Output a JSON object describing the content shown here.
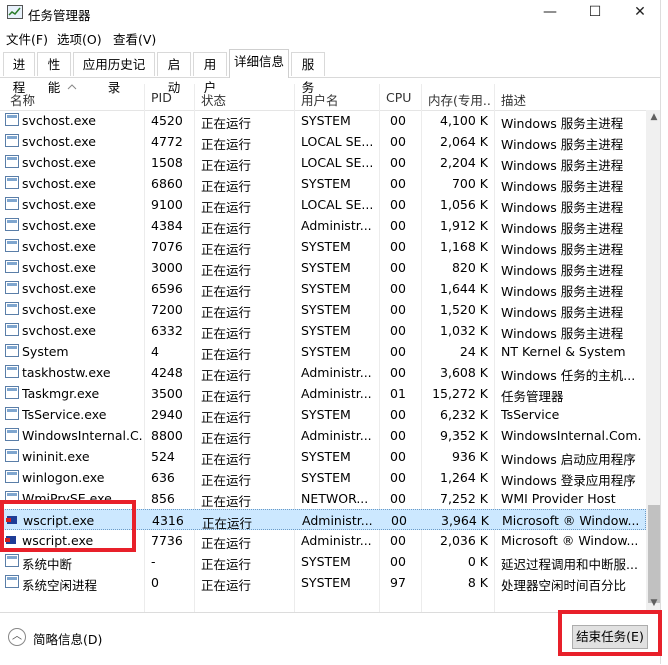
{
  "window": {
    "title": "任务管理器",
    "minimize": "—",
    "maximize": "☐",
    "close": "✕"
  },
  "menu": [
    "文件(F)",
    "选项(O)",
    "查看(V)"
  ],
  "tabs": [
    "进程",
    "性能",
    "应用历史记录",
    "启动",
    "用户",
    "详细信息",
    "服务"
  ],
  "active_tab": "详细信息",
  "columns": {
    "name": "名称",
    "pid": "PID",
    "status": "状态",
    "user": "用户名",
    "cpu": "CPU",
    "mem": "内存(专用...",
    "desc": "描述"
  },
  "rows": [
    {
      "name": "svchost.exe",
      "pid": "4520",
      "status": "正在运行",
      "user": "SYSTEM",
      "cpu": "00",
      "mem": "4,100 K",
      "desc": "Windows 服务主进程"
    },
    {
      "name": "svchost.exe",
      "pid": "4772",
      "status": "正在运行",
      "user": "LOCAL SE...",
      "cpu": "00",
      "mem": "2,064 K",
      "desc": "Windows 服务主进程"
    },
    {
      "name": "svchost.exe",
      "pid": "1508",
      "status": "正在运行",
      "user": "LOCAL SE...",
      "cpu": "00",
      "mem": "2,204 K",
      "desc": "Windows 服务主进程"
    },
    {
      "name": "svchost.exe",
      "pid": "6860",
      "status": "正在运行",
      "user": "SYSTEM",
      "cpu": "00",
      "mem": "700 K",
      "desc": "Windows 服务主进程"
    },
    {
      "name": "svchost.exe",
      "pid": "9100",
      "status": "正在运行",
      "user": "LOCAL SE...",
      "cpu": "00",
      "mem": "1,056 K",
      "desc": "Windows 服务主进程"
    },
    {
      "name": "svchost.exe",
      "pid": "4384",
      "status": "正在运行",
      "user": "Administr...",
      "cpu": "00",
      "mem": "1,912 K",
      "desc": "Windows 服务主进程"
    },
    {
      "name": "svchost.exe",
      "pid": "7076",
      "status": "正在运行",
      "user": "SYSTEM",
      "cpu": "00",
      "mem": "1,168 K",
      "desc": "Windows 服务主进程"
    },
    {
      "name": "svchost.exe",
      "pid": "3000",
      "status": "正在运行",
      "user": "SYSTEM",
      "cpu": "00",
      "mem": "820 K",
      "desc": "Windows 服务主进程"
    },
    {
      "name": "svchost.exe",
      "pid": "6596",
      "status": "正在运行",
      "user": "SYSTEM",
      "cpu": "00",
      "mem": "1,644 K",
      "desc": "Windows 服务主进程"
    },
    {
      "name": "svchost.exe",
      "pid": "7200",
      "status": "正在运行",
      "user": "SYSTEM",
      "cpu": "00",
      "mem": "1,520 K",
      "desc": "Windows 服务主进程"
    },
    {
      "name": "svchost.exe",
      "pid": "6332",
      "status": "正在运行",
      "user": "SYSTEM",
      "cpu": "00",
      "mem": "1,032 K",
      "desc": "Windows 服务主进程"
    },
    {
      "name": "System",
      "pid": "4",
      "status": "正在运行",
      "user": "SYSTEM",
      "cpu": "00",
      "mem": "24 K",
      "desc": "NT Kernel & System"
    },
    {
      "name": "taskhostw.exe",
      "pid": "4248",
      "status": "正在运行",
      "user": "Administr...",
      "cpu": "00",
      "mem": "3,608 K",
      "desc": "Windows 任务的主机..."
    },
    {
      "name": "Taskmgr.exe",
      "pid": "3500",
      "status": "正在运行",
      "user": "Administr...",
      "cpu": "01",
      "mem": "15,272 K",
      "desc": "任务管理器"
    },
    {
      "name": "TsService.exe",
      "pid": "2940",
      "status": "正在运行",
      "user": "SYSTEM",
      "cpu": "00",
      "mem": "6,232 K",
      "desc": "TsService"
    },
    {
      "name": "WindowsInternal.C...",
      "pid": "8800",
      "status": "正在运行",
      "user": "Administr...",
      "cpu": "00",
      "mem": "9,352 K",
      "desc": "WindowsInternal.Com..."
    },
    {
      "name": "wininit.exe",
      "pid": "524",
      "status": "正在运行",
      "user": "SYSTEM",
      "cpu": "00",
      "mem": "936 K",
      "desc": "Windows 启动应用程序"
    },
    {
      "name": "winlogon.exe",
      "pid": "636",
      "status": "正在运行",
      "user": "SYSTEM",
      "cpu": "00",
      "mem": "1,264 K",
      "desc": "Windows 登录应用程序"
    },
    {
      "name": "WmiPrvSE.exe",
      "pid": "856",
      "status": "正在运行",
      "user": "NETWOR...",
      "cpu": "00",
      "mem": "7,252 K",
      "desc": "WMI Provider Host"
    },
    {
      "name": "wscript.exe",
      "pid": "4316",
      "status": "正在运行",
      "user": "Administr...",
      "cpu": "00",
      "mem": "3,964 K",
      "desc": "Microsoft ® Window..."
    },
    {
      "name": "wscript.exe",
      "pid": "7736",
      "status": "正在运行",
      "user": "Administr...",
      "cpu": "00",
      "mem": "2,036 K",
      "desc": "Microsoft ® Window..."
    },
    {
      "name": "系统中断",
      "pid": "-",
      "status": "正在运行",
      "user": "SYSTEM",
      "cpu": "00",
      "mem": "0 K",
      "desc": "延迟过程调用和中断服..."
    },
    {
      "name": "系统空闲进程",
      "pid": "0",
      "status": "正在运行",
      "user": "SYSTEM",
      "cpu": "97",
      "mem": "8 K",
      "desc": "处理器空闲时间百分比"
    }
  ],
  "selected_row": 19,
  "footer": {
    "less_details": "简略信息(D)",
    "end_task": "结束任务(E)"
  },
  "colors": {
    "selection": "#cce8ff",
    "highlight_box": "#e8202a"
  }
}
